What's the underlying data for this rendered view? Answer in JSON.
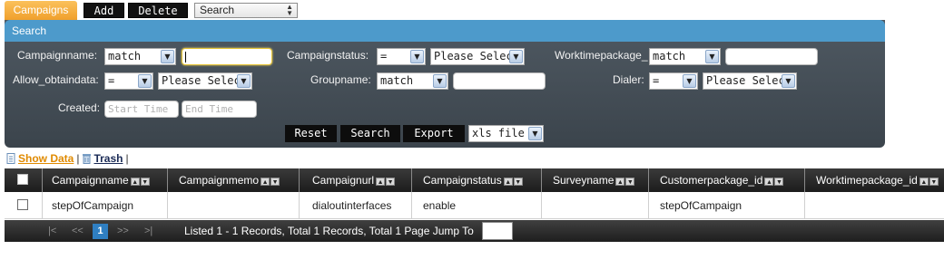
{
  "toolbar": {
    "tab_label": "Campaigns",
    "add_label": "Add",
    "delete_label": "Delete",
    "view_select_value": "Search",
    "view_select_arrow": "⌃⌄"
  },
  "search": {
    "header": "Search",
    "campaignname_label": "Campaignname:",
    "campaignname_op": "match",
    "campaignstatus_label": "Campaignstatus:",
    "campaignstatus_op": "=",
    "campaignstatus_value": "Please Select",
    "worktimepackage_label": "Worktimepackage_",
    "worktimepackage_op": "match",
    "allow_obtaindata_label": "Allow_obtaindata:",
    "allow_obtaindata_op": "=",
    "allow_obtaindata_value": "Please Select",
    "groupname_label": "Groupname:",
    "groupname_op": "match",
    "dialer_label": "Dialer:",
    "dialer_op": "=",
    "dialer_value": "Please Select",
    "created_label": "Created:",
    "start_time_placeholder": "Start Time",
    "end_time_placeholder": "End Time",
    "reset_label": "Reset",
    "search_label": "Search",
    "export_label": "Export",
    "export_format": "xls file"
  },
  "links": {
    "show_data": "Show Data",
    "separator": "|",
    "trash": "Trash"
  },
  "grid": {
    "columns": [
      "Campaignname",
      "Campaignmemo",
      "Campaignurl",
      "Campaignstatus",
      "Surveyname",
      "Customerpackage_id",
      "Worktimepackage_id"
    ],
    "rows": [
      [
        "stepOfCampaign",
        "",
        "dialoutinterfaces",
        "enable",
        "",
        "stepOfCampaign",
        ""
      ]
    ]
  },
  "pager": {
    "first": "|<",
    "prev": "<<",
    "current": "1",
    "next": ">>",
    "last": ">|",
    "info": "Listed 1 - 1 Records, Total 1 Records, Total 1 Page Jump To"
  },
  "colors": {
    "accent_orange": "#f0a02c",
    "search_header_blue": "#4d9acb",
    "panel_dark": "#3b444c",
    "pager_current": "#2f7fc2"
  }
}
